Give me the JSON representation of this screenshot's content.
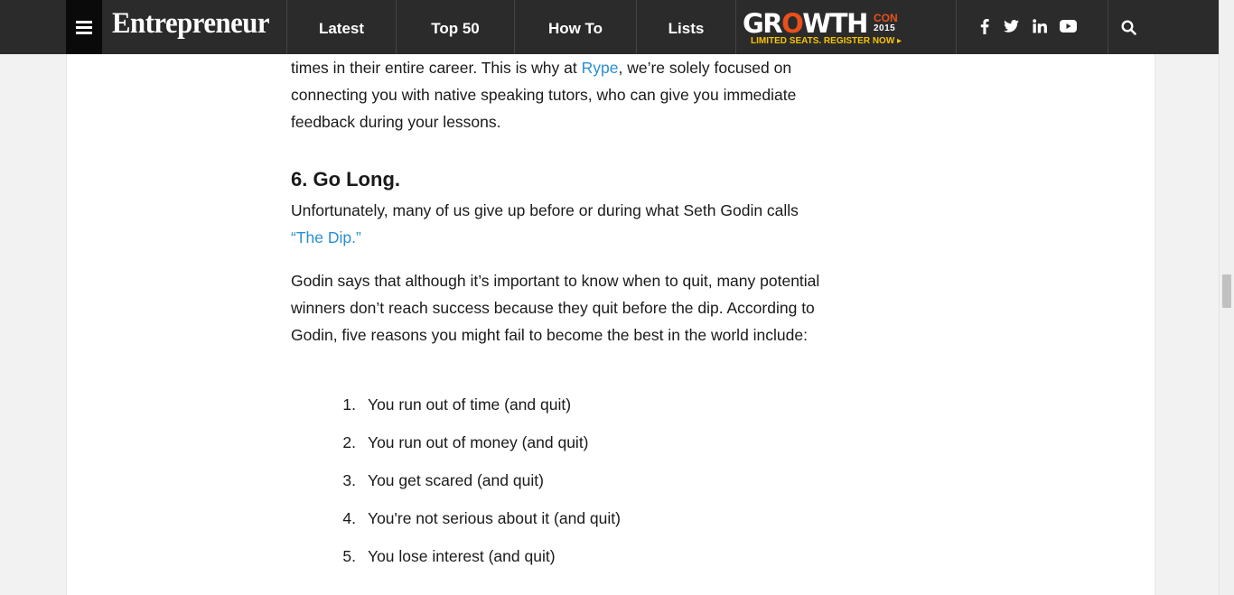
{
  "nav": {
    "logo": "Entrepreneur",
    "items": [
      "Latest",
      "Top 50",
      "How To",
      "Lists"
    ],
    "promo": {
      "word_start": "GR",
      "word_o": "O",
      "word_end": "WTH",
      "con": "CON",
      "year": "2015",
      "cta": "LIMITED SEATS. REGISTER NOW ▸"
    },
    "social_icons": [
      "facebook-icon",
      "twitter-icon",
      "linkedin-icon",
      "youtube-icon"
    ],
    "search_icon": "search-icon"
  },
  "article": {
    "p1_before": "times in their entire career. This is why at ",
    "p1_link": "Rype",
    "p1_after": ", we’re solely focused on connecting you with native speaking tutors, who can give you immediate feedback during your lessons.",
    "heading": "6. Go Long.",
    "p2_before": "Unfortunately, many of us give up before or during what Seth Godin calls ",
    "p2_link": "“The Dip.”",
    "p3": "Godin says that although it’s important to know when to quit, many potential winners don’t reach success because they quit before the dip. According to Godin, five reasons you might fail to become the best in the world include:",
    "reasons": [
      {
        "num": "1.",
        "text": "You run out of time (and quit)"
      },
      {
        "num": "2.",
        "text": "You run out of money (and quit)"
      },
      {
        "num": "3.",
        "text": "You get scared (and quit)"
      },
      {
        "num": "4.",
        "text": "You're not serious about it (and quit)"
      },
      {
        "num": "5.",
        "text": "You lose interest (and quit)"
      }
    ]
  },
  "colors": {
    "nav_bg": "#2b2b2b",
    "link": "#2a8fd1",
    "promo_accent": "#e8501c",
    "promo_cta": "#f5c400"
  }
}
